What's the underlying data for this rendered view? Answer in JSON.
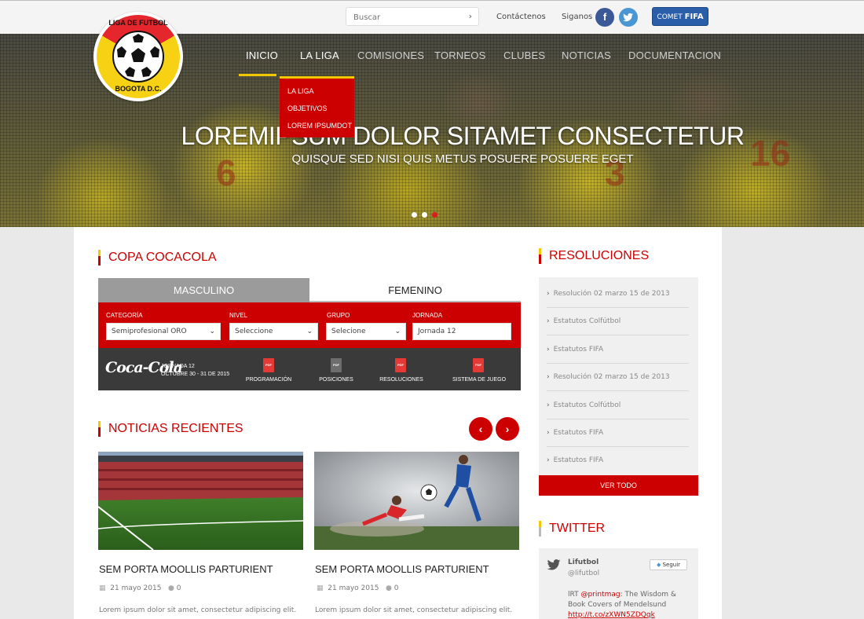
{
  "topbar": {
    "search_placeholder": "Buscar",
    "contact": "Contáctenos",
    "follow": "Siganos",
    "facebook_icon": "f",
    "twitter_icon": "t",
    "comet_label": "COMET",
    "comet_brand": "FIFA"
  },
  "logo": {
    "top_text": "LIGA DE FUTBOL",
    "bottom_text": "BOGOTA D.C."
  },
  "nav": {
    "items": [
      "INICIO",
      "LA LIGA",
      "COMISIONES",
      "TORNEOS",
      "CLUBES",
      "NOTICIAS",
      "DOCUMENTACION"
    ],
    "dropdown": [
      "LA LIGA",
      "OBJETIVOS",
      "LOREM IPSUMDOT"
    ]
  },
  "hero": {
    "title": "LOREMIPSUM DOLOR SITAMET CONSECTETUR",
    "subtitle": "QUISQUE SED NISI QUIS METUS POSUERE POSUERE EGET",
    "jersey_numbers": [
      "6",
      "3",
      "16"
    ],
    "active_slide": 3
  },
  "copa": {
    "title": "COPA COCACOLA",
    "tabs": [
      "MASCULINO",
      "FEMENINO"
    ],
    "filters": [
      {
        "label": "CATEGORÍA",
        "value": "Semiprofesional ORO"
      },
      {
        "label": "NIVEL",
        "value": "Seleccione"
      },
      {
        "label": "GRUPO",
        "value": "Selecione"
      },
      {
        "label": "JORNADA",
        "value": "Jornada 12"
      }
    ],
    "sponsor": "Coca-Cola",
    "jornada": "JORNADA 12",
    "dates": "OCTUBRE 30 - 31 DE 2015",
    "pdf_icon_text": "PDF",
    "docs": [
      "PROGRAMACIÓN",
      "POSICIONES",
      "RESOLUCIONES",
      "SISTEMA DE JUEGO"
    ]
  },
  "news": {
    "title": "NOTICIAS RECIENTES",
    "prev": "‹",
    "next": "›",
    "items": [
      {
        "title": "SEM PORTA MOOLLIS PARTURIENT",
        "date": "21 mayo 2015",
        "comments": "0",
        "excerpt": "Lorem ipsum dolor sit amet, consectetur adipiscing elit."
      },
      {
        "title": "SEM PORTA MOOLLIS PARTURIENT",
        "date": "21 mayo 2015",
        "comments": "0",
        "excerpt": "Lorem ipsum dolor sit amet, consectetur adipiscing elit."
      }
    ]
  },
  "resoluciones": {
    "title": "RESOLUCIONES",
    "items": [
      "Resolución 02 marzo 15 de 2013",
      "Estatutos Colfútbol",
      "Estatutos FIFA",
      "Resolución 02 marzo 15 de 2013",
      "Estatutos Colfútbol",
      "Estatutos FIFA",
      "Estatutos FIFA"
    ],
    "view_all": "VER TODO"
  },
  "twitter": {
    "title": "TWITTER",
    "name": "Lifutbol",
    "handle": "@lifutbol",
    "follow": "Seguir",
    "tweet_prefix": "lRT ",
    "tweet_mention": "@printmag",
    "tweet_text": ": The Wisdom & Book Covers of Mendelsund",
    "tweet_link": "http://t.co/zXWN5ZDQqk"
  },
  "colors": {
    "brand_red": "#cc0000",
    "accent_yellow": "#f2c900",
    "facebook": "#3b5997",
    "twitter": "#4a96d2"
  }
}
